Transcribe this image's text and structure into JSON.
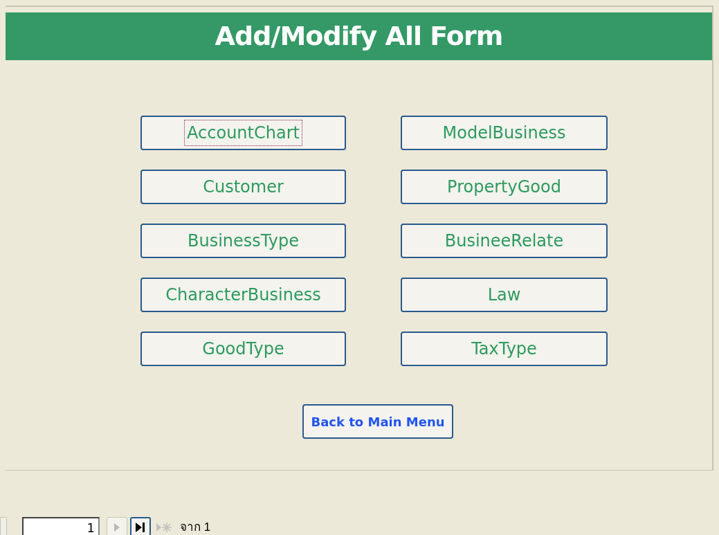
{
  "form": {
    "title": "Add/Modify All Form",
    "buttons": [
      {
        "label": "AccountChart",
        "focused": true
      },
      {
        "label": "ModelBusiness",
        "focused": false
      },
      {
        "label": "Customer",
        "focused": false
      },
      {
        "label": "PropertyGood",
        "focused": false
      },
      {
        "label": "BusinessType",
        "focused": false
      },
      {
        "label": "BusineeRelate",
        "focused": false
      },
      {
        "label": "CharacterBusiness",
        "focused": false
      },
      {
        "label": "Law",
        "focused": false
      },
      {
        "label": "GoodType",
        "focused": false
      },
      {
        "label": "TaxType",
        "focused": false
      }
    ],
    "back_button": {
      "label": "Back to Main Menu"
    }
  },
  "record_navigator": {
    "current": "1",
    "new_record_disabled": true,
    "total": "จาก 1"
  }
}
